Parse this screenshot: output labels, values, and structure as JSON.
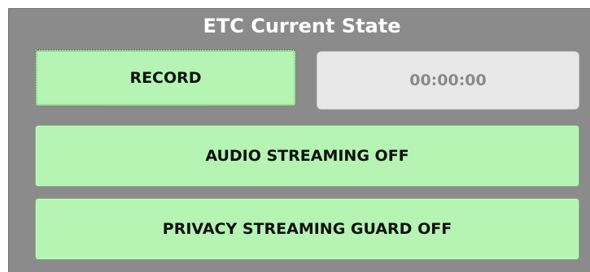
{
  "window": {
    "title": "ETC Current State"
  },
  "controls": {
    "record_label": "RECORD",
    "timer_value": "00:00:00",
    "audio_streaming_label": "AUDIO STREAMING OFF",
    "privacy_guard_label": "PRIVACY STREAMING GUARD OFF"
  },
  "colors": {
    "panel_background": "#8b8b8b",
    "button_green": "#b5f4b3",
    "timer_background": "#e8e8e8",
    "title_text": "#ffffff"
  }
}
